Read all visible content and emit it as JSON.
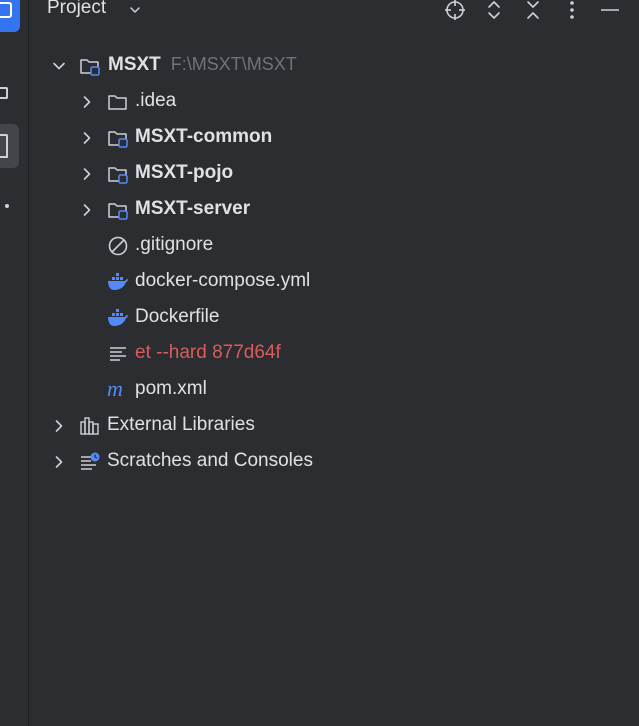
{
  "header": {
    "title": "Project"
  },
  "tree": {
    "root": {
      "name": "MSXT",
      "path": "F:\\MSXT\\MSXT"
    },
    "children": [
      {
        "label": ".idea"
      },
      {
        "label": "MSXT-common"
      },
      {
        "label": "MSXT-pojo"
      },
      {
        "label": "MSXT-server"
      },
      {
        "label": ".gitignore"
      },
      {
        "label": "docker-compose.yml"
      },
      {
        "label": "Dockerfile"
      },
      {
        "label": "et --hard 877d64f"
      },
      {
        "label": "pom.xml"
      }
    ],
    "external_libraries": "External Libraries",
    "scratches": "Scratches and Consoles"
  },
  "colors": {
    "background": "#2b2d30",
    "accent": "#3574f0",
    "text": "#dfe1e5",
    "muted": "#6f737a",
    "error": "#db5c5c",
    "docker": "#548af7"
  }
}
